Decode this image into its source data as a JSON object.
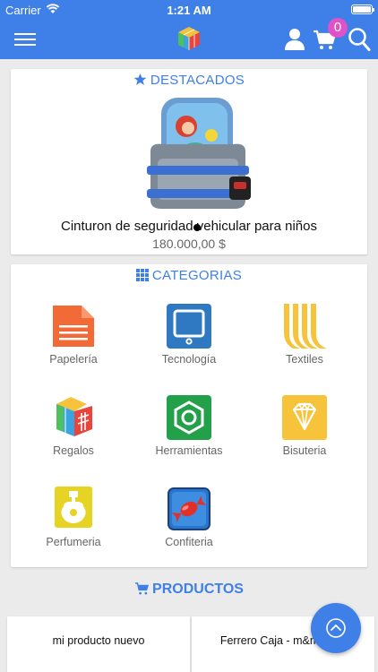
{
  "status_bar": {
    "carrier": "Carrier",
    "time": "1:21 AM"
  },
  "navbar": {
    "cart_count": "0",
    "icons": [
      "menu-icon",
      "logo-cube",
      "user-icon",
      "cart-icon",
      "search-icon"
    ]
  },
  "featured": {
    "title": "DESTACADOS",
    "title_icon": "star-icon",
    "product_name": "Cinturon de seguridad vehicular para niños",
    "product_price": "180.000,00 $"
  },
  "categories": {
    "title": "CATEGORIAS",
    "title_icon": "grid-icon",
    "items": [
      {
        "label": "Papelería",
        "icon": "document-icon"
      },
      {
        "label": "Tecnología",
        "icon": "monitor-icon"
      },
      {
        "label": "Textiles",
        "icon": "textile-icon"
      },
      {
        "label": "Regalos",
        "icon": "gift-cube-icon"
      },
      {
        "label": "Herramientas",
        "icon": "nut-icon"
      },
      {
        "label": "Bisuteria",
        "icon": "diamond-icon"
      },
      {
        "label": "Perfumeria",
        "icon": "perfume-icon"
      },
      {
        "label": "Confiteria",
        "icon": "candy-icon"
      }
    ]
  },
  "products": {
    "title": "PRODUCTOS",
    "title_icon": "cart-icon",
    "items": [
      {
        "name": "mi producto nuevo"
      },
      {
        "name": "Ferrero Caja - m&m Ch..."
      }
    ]
  },
  "colors": {
    "primary": "#3f7fe8",
    "badge": "#e052c8"
  }
}
